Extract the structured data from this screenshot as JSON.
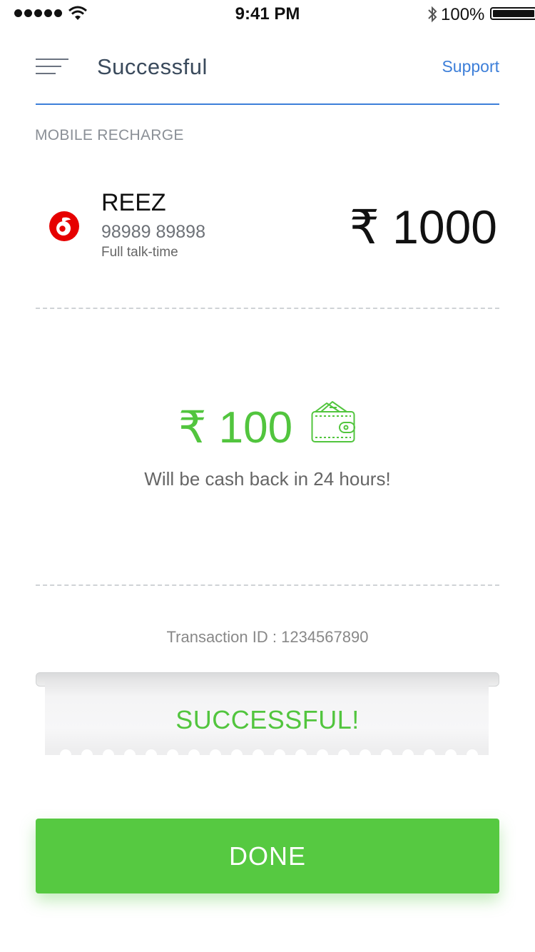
{
  "status_bar": {
    "time": "9:41 PM",
    "battery": "100%"
  },
  "header": {
    "title": "Successful",
    "support_label": "Support"
  },
  "section_label": "MOBILE RECHARGE",
  "recharge": {
    "operator": "REEZ",
    "number": "98989 89898",
    "plan": "Full talk-time",
    "amount": "₹ 1000"
  },
  "cashback": {
    "amount": "₹ 100",
    "message": "Will be cash back in 24 hours!"
  },
  "transaction": {
    "text": "Transaction ID  :  1234567890"
  },
  "ticket": {
    "status": "SUCCESSFUL!"
  },
  "done_label": "DONE",
  "colors": {
    "accent_blue": "#3d7fd9",
    "success_green": "#52c53e",
    "button_green": "#56c941",
    "operator_red": "#e60000"
  },
  "icons": [
    "signal-dots-icon",
    "wifi-icon",
    "bluetooth-icon",
    "battery-icon",
    "menu-icon",
    "operator-logo-icon",
    "wallet-icon"
  ]
}
